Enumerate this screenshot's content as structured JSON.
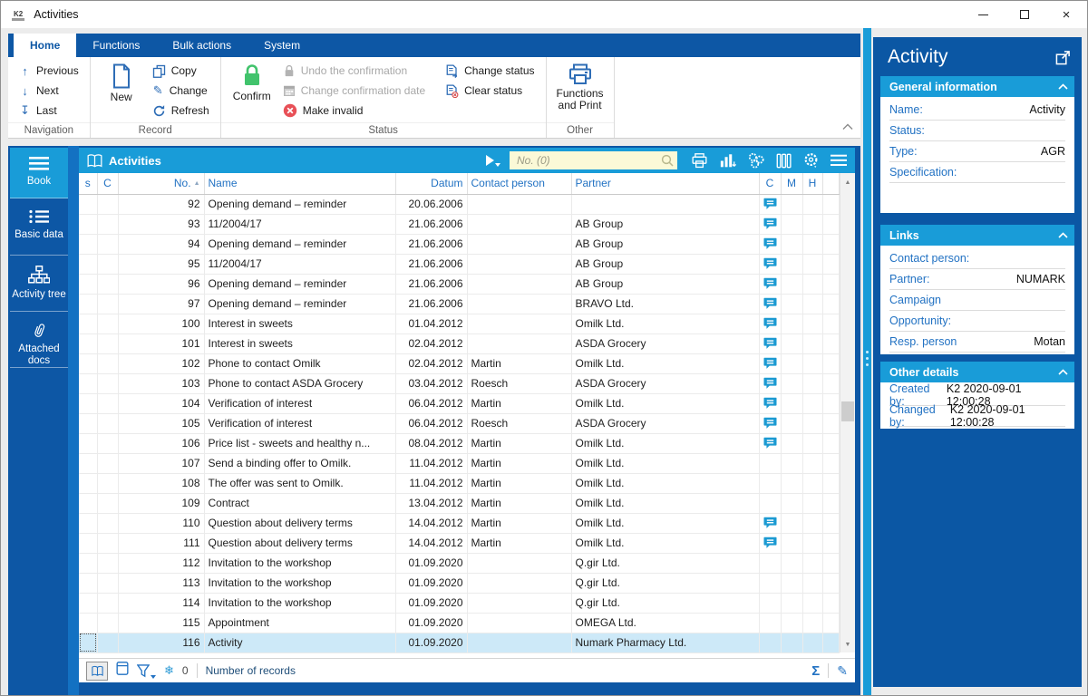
{
  "window": {
    "title": "Activities",
    "app_badge": "K2"
  },
  "ribbon": {
    "tabs": [
      {
        "label": "Home",
        "active": true
      },
      {
        "label": "Functions"
      },
      {
        "label": "Bulk actions"
      },
      {
        "label": "System"
      }
    ],
    "groups": {
      "navigation": "Navigation",
      "record": "Record",
      "status": "Status",
      "other": "Other"
    },
    "buttons": {
      "previous": "Previous",
      "next": "Next",
      "last": "Last",
      "new": "New",
      "copy": "Copy",
      "change": "Change",
      "refresh": "Refresh",
      "confirm": "Confirm",
      "undo_confirmation": "Undo the confirmation",
      "change_confirmation_date": "Change confirmation date",
      "make_invalid": "Make invalid",
      "change_status": "Change status",
      "clear_status": "Clear status",
      "functions_and_print": "Functions and Print"
    }
  },
  "sidebar": {
    "items": [
      {
        "label": "Book",
        "active": true
      },
      {
        "label": "Basic data"
      },
      {
        "label": "Activity tree"
      },
      {
        "label": "Attached docs"
      }
    ]
  },
  "browser": {
    "title": "Activities",
    "search_placeholder": "No. (0)",
    "columns": [
      "s",
      "C",
      "No.",
      "Name",
      "Datum",
      "Contact person",
      "Partner",
      "C",
      "M",
      "H"
    ],
    "rows": [
      {
        "no": "92",
        "name": "Opening demand – reminder",
        "datum": "20.06.2006",
        "contact": "",
        "partner": "",
        "comment": true
      },
      {
        "no": "93",
        "name": "11/2004/17",
        "datum": "21.06.2006",
        "contact": "",
        "partner": "AB Group",
        "comment": true
      },
      {
        "no": "94",
        "name": "Opening demand – reminder",
        "datum": "21.06.2006",
        "contact": "",
        "partner": "AB Group",
        "comment": true
      },
      {
        "no": "95",
        "name": "11/2004/17",
        "datum": "21.06.2006",
        "contact": "",
        "partner": "AB Group",
        "comment": true
      },
      {
        "no": "96",
        "name": "Opening demand – reminder",
        "datum": "21.06.2006",
        "contact": "",
        "partner": "AB Group",
        "comment": true
      },
      {
        "no": "97",
        "name": "Opening demand – reminder",
        "datum": "21.06.2006",
        "contact": "",
        "partner": "BRAVO Ltd.",
        "comment": true
      },
      {
        "no": "100",
        "name": "Interest in sweets",
        "datum": "01.04.2012",
        "contact": "",
        "partner": "Omilk Ltd.",
        "comment": true
      },
      {
        "no": "101",
        "name": "Interest in sweets",
        "datum": "02.04.2012",
        "contact": "",
        "partner": "ASDA Grocery",
        "comment": true
      },
      {
        "no": "102",
        "name": "Phone to contact Omilk",
        "datum": "02.04.2012",
        "contact": "Martin",
        "partner": "Omilk Ltd.",
        "comment": true
      },
      {
        "no": "103",
        "name": "Phone to contact ASDA Grocery",
        "datum": "03.04.2012",
        "contact": "Roesch",
        "partner": "ASDA Grocery",
        "comment": true
      },
      {
        "no": "104",
        "name": "Verification of interest",
        "datum": "06.04.2012",
        "contact": "Martin",
        "partner": "Omilk Ltd.",
        "comment": true
      },
      {
        "no": "105",
        "name": "Verification of interest",
        "datum": "06.04.2012",
        "contact": "Roesch",
        "partner": "ASDA Grocery",
        "comment": true
      },
      {
        "no": "106",
        "name": "Price list - sweets and healthy n...",
        "datum": "08.04.2012",
        "contact": "Martin",
        "partner": "Omilk Ltd.",
        "comment": true
      },
      {
        "no": "107",
        "name": "Send a binding offer to Omilk.",
        "datum": "11.04.2012",
        "contact": "Martin",
        "partner": "Omilk Ltd.",
        "comment": false
      },
      {
        "no": "108",
        "name": "The offer was sent to Omilk.",
        "datum": "11.04.2012",
        "contact": "Martin",
        "partner": "Omilk Ltd.",
        "comment": false
      },
      {
        "no": "109",
        "name": "Contract",
        "datum": "13.04.2012",
        "contact": "Martin",
        "partner": "Omilk Ltd.",
        "comment": false
      },
      {
        "no": "110",
        "name": "Question about delivery terms",
        "datum": "14.04.2012",
        "contact": "Martin",
        "partner": "Omilk Ltd.",
        "comment": true
      },
      {
        "no": "111",
        "name": "Question about delivery terms",
        "datum": "14.04.2012",
        "contact": "Martin",
        "partner": "Omilk Ltd.",
        "comment": true
      },
      {
        "no": "112",
        "name": "Invitation to the workshop",
        "datum": "01.09.2020",
        "contact": "",
        "partner": "Q.gir Ltd.",
        "comment": false
      },
      {
        "no": "113",
        "name": "Invitation to the workshop",
        "datum": "01.09.2020",
        "contact": "",
        "partner": "Q.gir Ltd.",
        "comment": false
      },
      {
        "no": "114",
        "name": "Invitation to the workshop",
        "datum": "01.09.2020",
        "contact": "",
        "partner": "Q.gir Ltd.",
        "comment": false
      },
      {
        "no": "115",
        "name": "Appointment",
        "datum": "01.09.2020",
        "contact": "",
        "partner": "OMEGA Ltd.",
        "comment": false
      },
      {
        "no": "116",
        "name": "Activity",
        "datum": "01.09.2020",
        "contact": "",
        "partner": "Numark Pharmacy Ltd.",
        "comment": false,
        "selected": true
      }
    ],
    "statusbar": {
      "freeze_count": "0",
      "records_label": "Number of records"
    }
  },
  "detail": {
    "title": "Activity",
    "sections": [
      {
        "title": "General information",
        "fields": [
          {
            "label": "Name:",
            "value": "Activity"
          },
          {
            "label": "Status:",
            "value": ""
          },
          {
            "label": "Type:",
            "value": "AGR"
          },
          {
            "label": "Specification:",
            "value": ""
          }
        ]
      },
      {
        "title": "Links",
        "fields": [
          {
            "label": "Contact person:",
            "value": ""
          },
          {
            "label": "Partner:",
            "value": "NUMARK"
          },
          {
            "label": "Campaign",
            "value": ""
          },
          {
            "label": "Opportunity:",
            "value": ""
          },
          {
            "label": "Resp. person",
            "value": "Motan"
          }
        ]
      },
      {
        "title": "Other details",
        "fields": [
          {
            "label": "Created by:",
            "value": "K2 2020-09-01 12:00:28"
          },
          {
            "label": "Changed by:",
            "value": "K2 2020-09-01 12:00:28"
          }
        ]
      }
    ]
  },
  "colors": {
    "accent": "#199cd8",
    "frame_blue": "#0d57a5",
    "icon_blue": "#2e6db6",
    "header_text": "#2272c3",
    "selected_row": "#cde9f8",
    "confirm_green": "#41c36c",
    "invalid_red": "#e2444d",
    "search_bg": "#fbf9d7"
  }
}
